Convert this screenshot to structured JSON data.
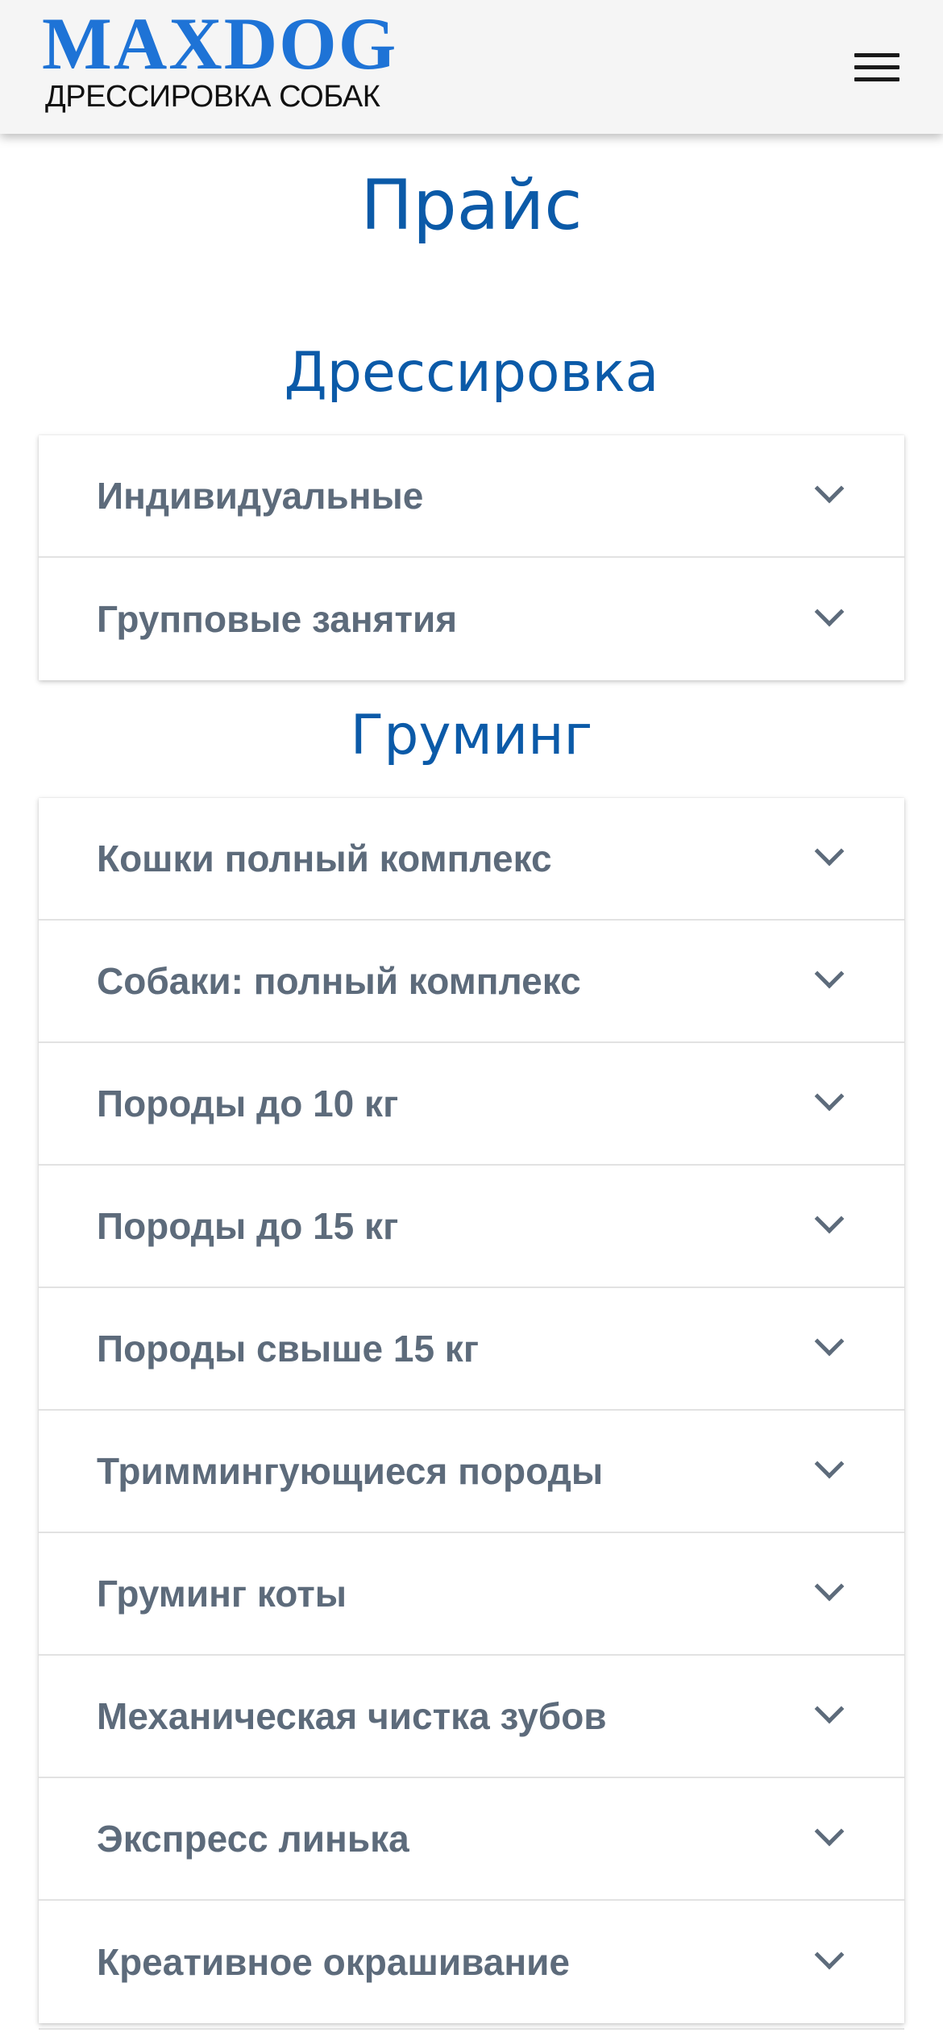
{
  "header": {
    "logo_main": "MAXDOG",
    "logo_sub": "ДРЕССИРОВКА СОБАК",
    "menu_icon": "hamburger-menu-icon"
  },
  "page": {
    "title": "Прайс"
  },
  "sections": [
    {
      "title": "Дрессировка",
      "items": [
        {
          "label": "Индивидуальные"
        },
        {
          "label": "Групповые занятия"
        }
      ]
    },
    {
      "title": "Груминг",
      "items": [
        {
          "label": "Кошки полный комплекс"
        },
        {
          "label": "Собаки: полный комплекс"
        },
        {
          "label": "Породы до 10 кг"
        },
        {
          "label": "Породы до 15 кг"
        },
        {
          "label": "Породы свыше 15 кг"
        },
        {
          "label": "Триммингующиеся породы"
        },
        {
          "label": "Груминг коты"
        },
        {
          "label": "Механическая чистка зубов"
        },
        {
          "label": "Экспресс линька"
        },
        {
          "label": "Креативное окрашивание"
        }
      ]
    }
  ],
  "colors": {
    "logo_blue": "#1e73d6",
    "heading_blue": "#0b5aa8",
    "item_text": "#5d6b7b",
    "header_bg": "#f5f5f5"
  }
}
